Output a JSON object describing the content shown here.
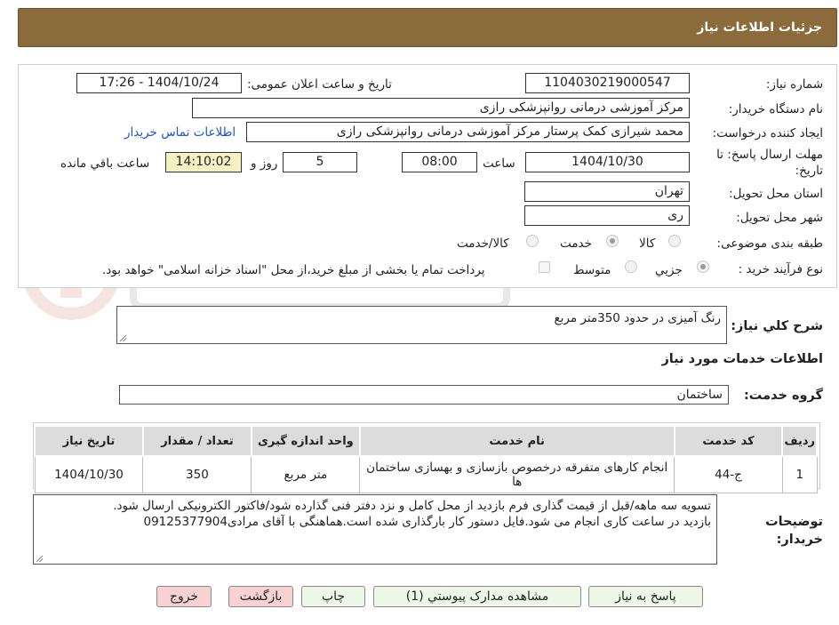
{
  "header": {
    "title": "جزئیات اطلاعات نیاز"
  },
  "form": {
    "need_number_label": "شماره نیاز:",
    "need_number": "1104030219000547",
    "announce_label": "تاریخ و ساعت اعلان عمومی:",
    "announce_value": "1404/10/24 - 17:26",
    "buyer_label": "نام دستگاه خریدار:",
    "buyer_value": "مرکز آموزشی درمانی روانپزشکی رازی",
    "requester_label": "ایجاد کننده درخواست:",
    "requester_value": "محمد شیرازی کمک پرستار مرکز آموزشی درمانی روانپزشکی رازی",
    "contact_link": "اطلاعات تماس خریدار",
    "deadline_label": "مهلت ارسال پاسخ: تا تاریخ:",
    "deadline_date": "1404/10/30",
    "time_label": "ساعت",
    "deadline_time": "08:00",
    "days_value": "5",
    "days_label": "روز و",
    "remaining_time": "14:10:02",
    "remaining_label": "ساعت باقي مانده",
    "province_label": "استان محل تحویل:",
    "province_value": "تهران",
    "city_label": "شهر محل تحویل:",
    "city_value": "ری",
    "category_label": "طبقه بندی موضوعی:",
    "category_options": [
      "کالا",
      "خدمت",
      "کالا/خدمت"
    ],
    "category_selected": "خدمت",
    "process_label": "نوع فرآیند خرید :",
    "process_options": [
      "جزيي",
      "متوسط"
    ],
    "process_selected": "جزيي",
    "payment_note": "پرداخت تمام یا بخشی از مبلغ خرید،از محل \"اسناد خزانه اسلامی\" خواهد بود."
  },
  "description": {
    "label": "شرح کلي نياز:",
    "value": "رنگ آمیزی در حدود 350متر مربع"
  },
  "services": {
    "section_title": "اطلاعات خدمات مورد نیاز",
    "group_label": "گروه خدمت:",
    "group_value": "ساختمان",
    "columns": [
      "ردیف",
      "کد خدمت",
      "نام خدمت",
      "واحد اندازه گیری",
      "تعداد / مقدار",
      "تاریخ نیاز"
    ],
    "rows": [
      {
        "index": "1",
        "code": "ج-44",
        "name": "انجام کارهای متفرقه درخصوص بازسازی و بهسازی ساختمان ها",
        "unit": "متر مربع",
        "qty": "350",
        "date": "1404/10/30"
      }
    ]
  },
  "buyer_notes": {
    "label": "توضیحات خریدار:",
    "line1": "تسویه سه ماهه/قبل از قیمت گذاری فرم بازدید از محل کامل و نزد دفتر فنی گذارده شود/فاکتور الکترونیکی ارسال شود.",
    "line2": "بازدید در ساعت کاری انجام می شود.فایل دستور کار بارگذاری شده است.هماهنگی با آقای مرادی09125377904"
  },
  "buttons": {
    "reply": "پاسخ به نیاز",
    "attachments": "مشاهده مدارک پیوستي (1)",
    "print": "چاپ",
    "back": "بازگشت",
    "exit": "خروج"
  },
  "colors": {
    "header_bg": "#8b6a3c",
    "highlight": "#f6f1c3",
    "link": "#1a56c8"
  }
}
